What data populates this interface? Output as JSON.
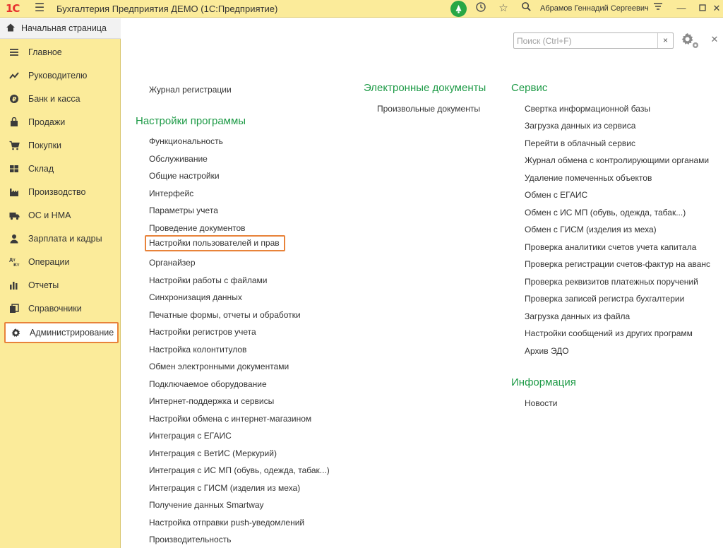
{
  "titlebar": {
    "logo": "1С",
    "title": "Бухгалтерия Предприятия ДЕМО  (1С:Предприятие)",
    "user": "Абрамов Геннадий Сергеевич"
  },
  "sidebar": {
    "home": "Начальная страница",
    "items": [
      {
        "label": "Главное",
        "icon": "menu-lines-icon"
      },
      {
        "label": "Руководителю",
        "icon": "trend-icon"
      },
      {
        "label": "Банк и касса",
        "icon": "coin-icon"
      },
      {
        "label": "Продажи",
        "icon": "shopping-bag-icon"
      },
      {
        "label": "Покупки",
        "icon": "cart-icon"
      },
      {
        "label": "Склад",
        "icon": "warehouse-icon"
      },
      {
        "label": "Производство",
        "icon": "factory-icon"
      },
      {
        "label": "ОС и НМА",
        "icon": "truck-icon"
      },
      {
        "label": "Зарплата и кадры",
        "icon": "person-icon"
      },
      {
        "label": "Операции",
        "icon": "debit-credit-icon"
      },
      {
        "label": "Отчеты",
        "icon": "bar-chart-icon"
      },
      {
        "label": "Справочники",
        "icon": "books-icon"
      },
      {
        "label": "Администрирование",
        "icon": "gear-icon"
      }
    ]
  },
  "search": {
    "placeholder": "Поиск (Ctrl+F)",
    "value": "",
    "clear": "×"
  },
  "col1": {
    "top_link": "Журнал регистрации",
    "heading": "Настройки программы",
    "links": [
      "Функциональность",
      "Обслуживание",
      "Общие настройки",
      "Интерфейс",
      "Параметры учета",
      "Проведение документов",
      "Настройки пользователей и прав",
      "Органайзер",
      "Настройки работы с файлами",
      "Синхронизация данных",
      "Печатные формы, отчеты и обработки",
      "Настройки регистров учета",
      "Настройка колонтитулов",
      "Обмен электронными документами",
      "Подключаемое оборудование",
      "Интернет-поддержка и сервисы",
      "Настройки обмена с интернет-магазином",
      "Интеграция с ЕГАИС",
      "Интеграция с ВетИС (Меркурий)",
      "Интеграция с ИС МП (обувь, одежда, табак...)",
      "Интеграция с ГИСМ (изделия из меха)",
      "Получение данных Smartway",
      "Настройка отправки push-уведомлений",
      "Производительность"
    ]
  },
  "col2": {
    "heading": "Электронные документы",
    "links": [
      "Произвольные документы"
    ]
  },
  "col3": {
    "heading": "Сервис",
    "links": [
      "Свертка информационной базы",
      "Загрузка данных из сервиса",
      "Перейти в облачный сервис",
      "Журнал обмена с контролирующими органами",
      "Удаление помеченных объектов",
      "Обмен с ЕГАИС",
      "Обмен с ИС МП (обувь, одежда, табак...)",
      "Обмен с ГИСМ (изделия из меха)",
      "Проверка аналитики счетов учета капитала",
      "Проверка регистрации счетов-фактур на аванс",
      "Проверка реквизитов платежных поручений",
      "Проверка записей регистра бухгалтерии",
      "Загрузка данных из файла",
      "Настройки сообщений из других программ",
      "Архив ЭДО"
    ],
    "heading2": "Информация",
    "links2": [
      "Новости"
    ]
  },
  "colors": {
    "accent_green": "#1d9a46",
    "highlight_orange": "#e8833a",
    "panel_yellow": "#fbeb9a"
  }
}
